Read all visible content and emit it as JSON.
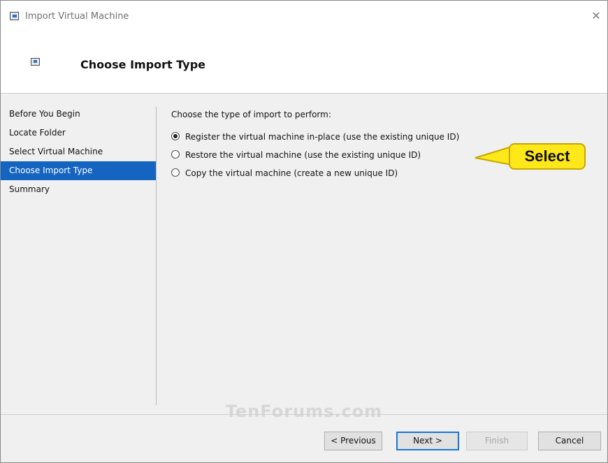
{
  "window": {
    "title": "Import Virtual Machine"
  },
  "header": {
    "title": "Choose Import Type"
  },
  "sidebar": {
    "items": [
      {
        "label": "Before You Begin"
      },
      {
        "label": "Locate Folder"
      },
      {
        "label": "Select Virtual Machine"
      },
      {
        "label": "Choose Import Type",
        "active": true
      },
      {
        "label": "Summary"
      }
    ]
  },
  "main": {
    "prompt": "Choose the type of import to perform:",
    "options": [
      {
        "label": "Register the virtual machine in-place (use the existing unique ID)",
        "selected": true
      },
      {
        "label": "Restore the virtual machine (use the existing unique ID)",
        "selected": false
      },
      {
        "label": "Copy the virtual machine (create a new unique ID)",
        "selected": false
      }
    ]
  },
  "callout": {
    "label": "Select",
    "color": "#ffe81a"
  },
  "watermark": "TenForums.com",
  "buttons": {
    "previous": "< Previous",
    "next": "Next >",
    "finish": "Finish",
    "cancel": "Cancel"
  },
  "colors": {
    "accent": "#1565c0"
  }
}
